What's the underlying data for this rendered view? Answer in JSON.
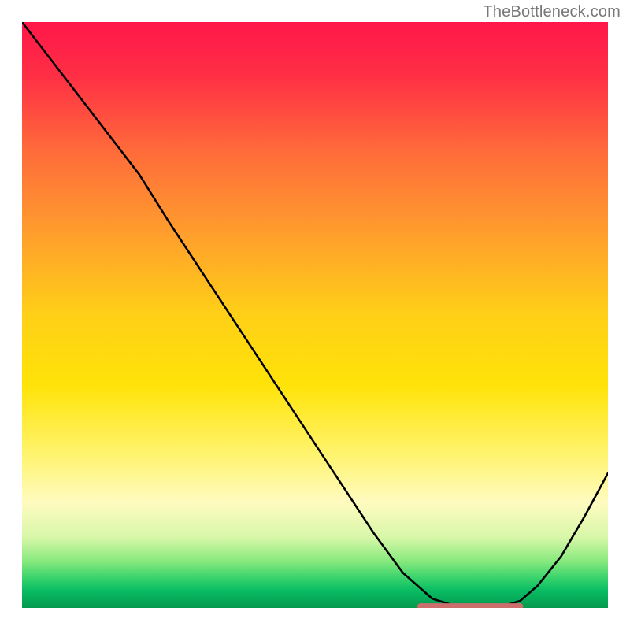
{
  "watermark": "TheBottleneck.com",
  "chart_data": {
    "type": "line",
    "title": "",
    "xlabel": "",
    "ylabel": "",
    "xlim": [
      0,
      100
    ],
    "ylim": [
      0,
      100
    ],
    "grid": false,
    "legend": false,
    "notes": "Underlying fill is a vertical gradient spanning red→orange→yellow→pale-yellow→green→deep-green. Single black curve overlaid; short salmon horizontal segment at the bottom near the curve's minimum.",
    "series": [
      {
        "name": "curve",
        "x": [
          0,
          5,
          10,
          15,
          20,
          25,
          30,
          35,
          40,
          45,
          50,
          55,
          60,
          65,
          70,
          74,
          78,
          82,
          85,
          88,
          92,
          96,
          100
        ],
        "y": [
          100,
          93.5,
          87,
          80.5,
          74,
          66,
          58.4,
          50.8,
          43.2,
          35.6,
          28,
          20.4,
          12.8,
          6,
          1.6,
          0.3,
          0.2,
          0.3,
          1.2,
          3.8,
          8.8,
          15.6,
          23
        ]
      }
    ],
    "marker_segment": {
      "name": "highlight",
      "x": [
        68,
        85
      ],
      "y": [
        0.25,
        0.25
      ]
    },
    "gradient_stops": [
      {
        "offset": 0,
        "color": "#ff174a"
      },
      {
        "offset": 9,
        "color": "#ff2e45"
      },
      {
        "offset": 22,
        "color": "#ff6b3a"
      },
      {
        "offset": 35,
        "color": "#ff9a2e"
      },
      {
        "offset": 50,
        "color": "#ffd017"
      },
      {
        "offset": 62,
        "color": "#ffe308"
      },
      {
        "offset": 74,
        "color": "#fff470"
      },
      {
        "offset": 82,
        "color": "#fffbc0"
      },
      {
        "offset": 88,
        "color": "#d7f7a8"
      },
      {
        "offset": 92,
        "color": "#88e97e"
      },
      {
        "offset": 95,
        "color": "#35d26c"
      },
      {
        "offset": 97,
        "color": "#09bd63"
      },
      {
        "offset": 100,
        "color": "#03994e"
      }
    ]
  }
}
